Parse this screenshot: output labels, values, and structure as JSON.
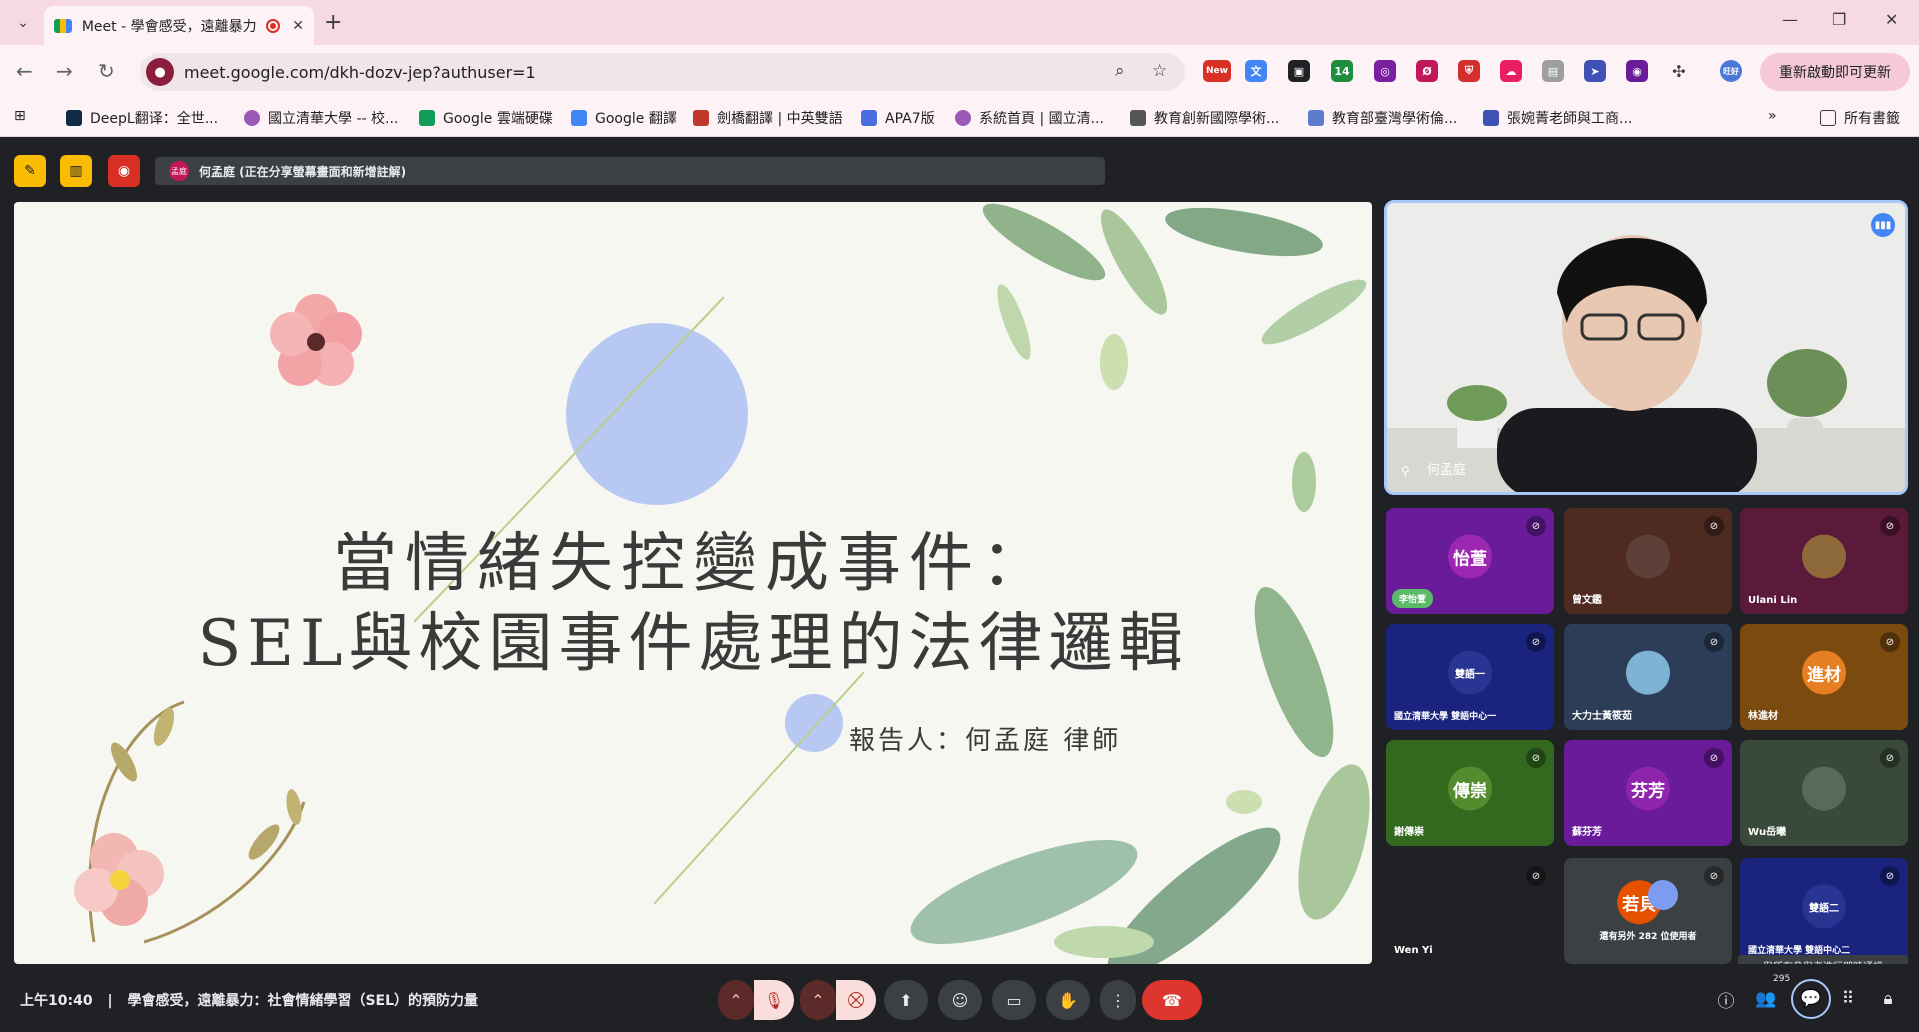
{
  "browser": {
    "tab_title": "Meet - 學會感受，遠離暴力",
    "url": "meet.google.com/dkh-dozv-jep?authuser=1",
    "update_label": "重新啟動即可更新",
    "ext_new_label": "New",
    "ext_count": "14",
    "profile_label": "旺好"
  },
  "bookmarks": [
    {
      "label": "DeepL翻译：全世...",
      "color": "#0f2b46"
    },
    {
      "label": "國立清華大學 -- 校...",
      "color": "#9b59b6"
    },
    {
      "label": "Google 雲端硬碟",
      "color": "#0f9d58"
    },
    {
      "label": "Google 翻譯",
      "color": "#4285f4"
    },
    {
      "label": "劍橋翻譯 | 中英雙語",
      "color": "#c0392b"
    },
    {
      "label": "APA7版",
      "color": "#4a6ee0"
    },
    {
      "label": "系統首頁 | 國立清...",
      "color": "#9b59b6"
    },
    {
      "label": "教育創新國際學術...",
      "color": "#555555"
    },
    {
      "label": "教育部臺灣學術倫...",
      "color": "#5b7ccf"
    },
    {
      "label": "張婉菁老師與工商...",
      "color": "#3f51b5"
    }
  ],
  "bookmarks_all": "所有書籤",
  "meet": {
    "presenter_avatar": "孟庭",
    "presenter_text": "何孟庭 (正在分享螢幕畫面和新增註解)"
  },
  "slide": {
    "title_line1": "當情緒失控變成事件：",
    "title_line2": "SEL與校園事件處理的法律邏輯",
    "reporter": "報告人：何孟庭  律師"
  },
  "main_video": {
    "name": "何孟庭"
  },
  "tiles": [
    {
      "label": "",
      "badge": "李怡萱",
      "avatar": "怡萱",
      "bg": "#6a1b9a",
      "avc": "#9c27b0"
    },
    {
      "label": "曾文鑑",
      "badge": "",
      "avatar": "",
      "bg": "#4e2a20",
      "avc": "#5d4037"
    },
    {
      "label": "Ulani Lin",
      "badge": "",
      "avatar": "",
      "bg": "#5b1a3a",
      "avc": "#8e6a3a"
    },
    {
      "label": "國立清華大學 雙語中心一",
      "badge": "",
      "avatar": "雙語一",
      "bg": "#1a237e",
      "avc": "#283593"
    },
    {
      "label": "大力士黃筱茹",
      "badge": "",
      "avatar": "",
      "bg": "#2c3e57",
      "avc": "#7fb3d5"
    },
    {
      "label": "林進材",
      "badge": "",
      "avatar": "進材",
      "bg": "#7a4a0e",
      "avc": "#e67e22"
    },
    {
      "label": "謝傳崇",
      "badge": "",
      "avatar": "傳崇",
      "bg": "#33691e",
      "avc": "#558b2f"
    },
    {
      "label": "蘇芬芳",
      "badge": "",
      "avatar": "芬芳",
      "bg": "#6a1b9a",
      "avc": "#8e24aa"
    },
    {
      "label": "Wu岳曦",
      "badge": "",
      "avatar": "",
      "bg": "#3a4a3a",
      "avc": "#5a6a5a"
    },
    {
      "label": "Wen Yi",
      "badge": "",
      "avatar": "",
      "bg": "#202124",
      "avc": "#202124"
    },
    {
      "label": "還有另外 282 位使用者",
      "badge": "",
      "avatar": "若貝",
      "bg": "#3c4043",
      "avc": "#e65100"
    },
    {
      "label": "國立清華大學 雙語中心二",
      "badge": "",
      "avatar": "雙語二",
      "bg": "#1a237e",
      "avc": "#283593"
    }
  ],
  "bottom": {
    "time": "上午10:40",
    "separator": "|",
    "meeting_title": "學會感受，遠離暴力：社會情緒學習（SEL）的預防力量",
    "tooltip": "與所有參與者進行即時通訊",
    "participant_count": "295"
  },
  "colors": {
    "accent": "#a8c7fa",
    "end_call": "#dc362e"
  }
}
